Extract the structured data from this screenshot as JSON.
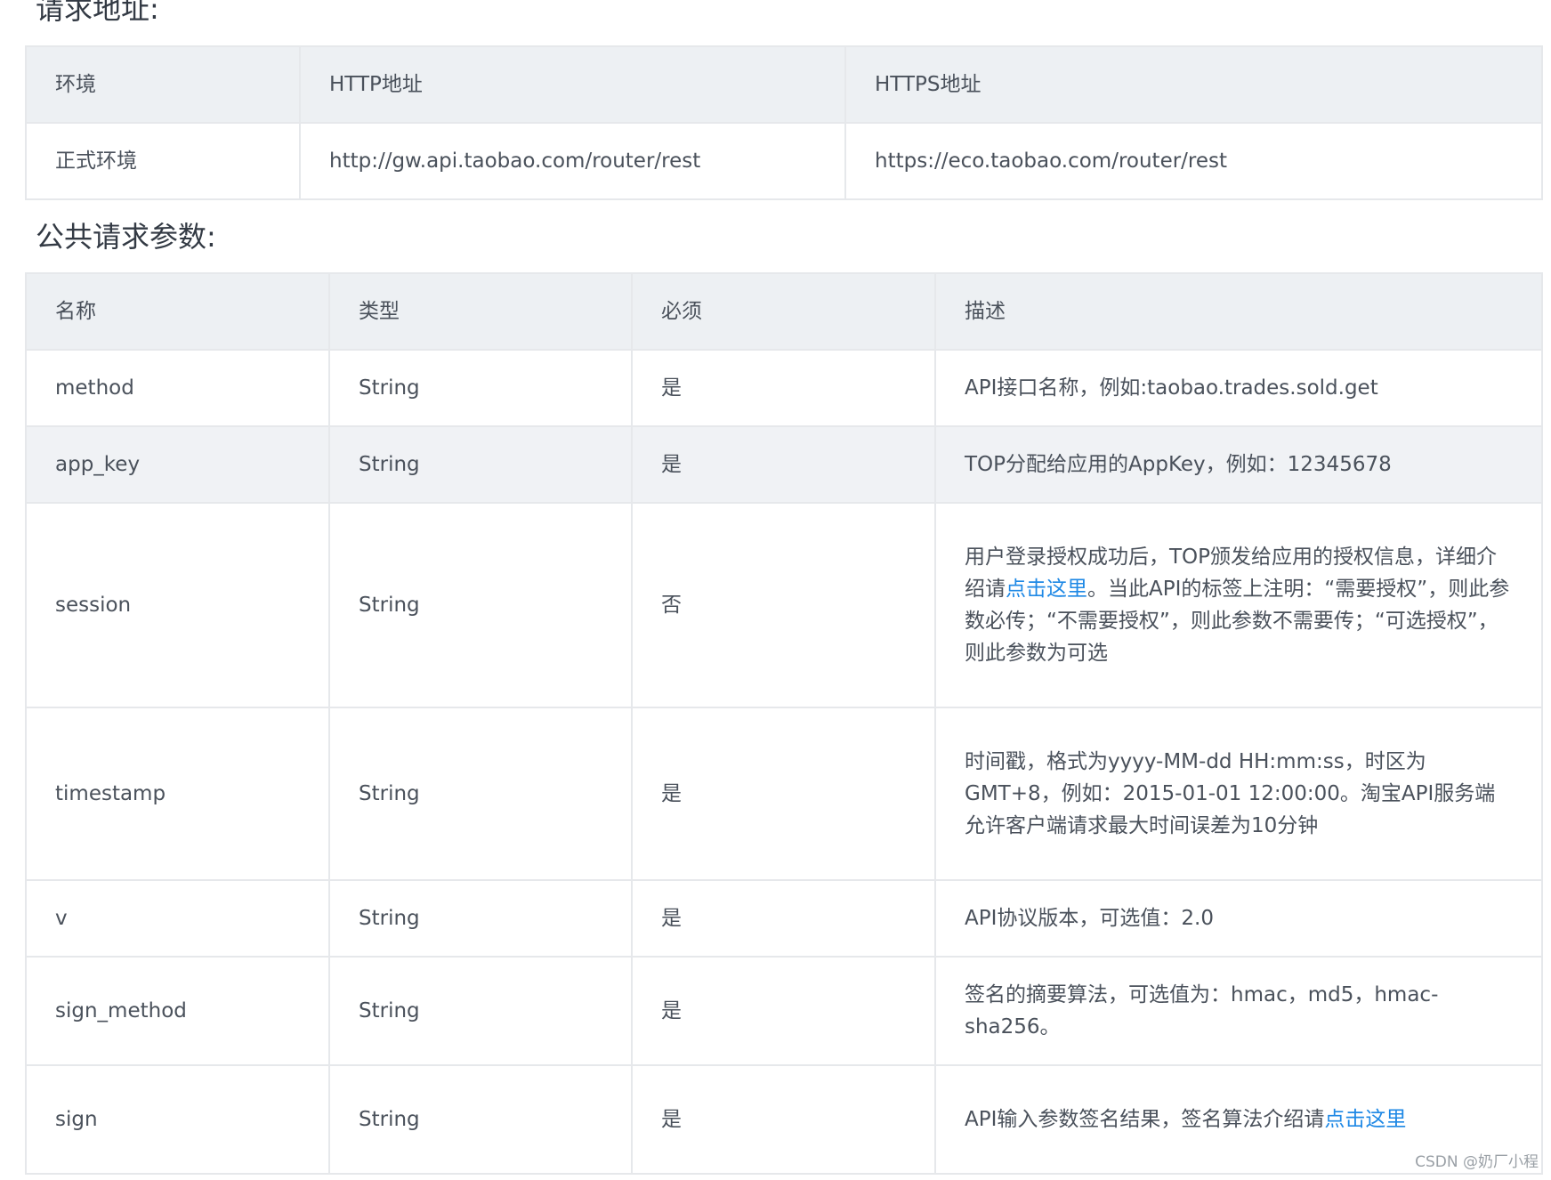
{
  "headings": {
    "request_address": "请求地址:",
    "common_params": "公共请求参数:"
  },
  "address_table": {
    "headers": [
      "环境",
      "HTTP地址",
      "HTTPS地址"
    ],
    "rows": [
      [
        "正式环境",
        "http://gw.api.taobao.com/router/rest",
        "https://eco.taobao.com/router/rest"
      ]
    ]
  },
  "params_table": {
    "headers": [
      "名称",
      "类型",
      "必须",
      "描述"
    ],
    "rows": [
      {
        "name": "method",
        "type": "String",
        "required": "是",
        "desc": "API接口名称，例如:taobao.trades.sold.get"
      },
      {
        "name": "app_key",
        "type": "String",
        "required": "是",
        "desc": "TOP分配给应用的AppKey，例如：12345678"
      },
      {
        "name": "session",
        "type": "String",
        "required": "否",
        "desc_before": "用户登录授权成功后，TOP颁发给应用的授权信息，详细介绍请",
        "desc_link": "点击这里",
        "desc_after": "。当此API的标签上注明：“需要授权”，则此参数必传；“不需要授权”，则此参数不需要传；“可选授权”，则此参数为可选"
      },
      {
        "name": "timestamp",
        "type": "String",
        "required": "是",
        "desc": "时间戳，格式为yyyy-MM-dd HH:mm:ss，时区为GMT+8，例如：2015-01-01 12:00:00。淘宝API服务端允许客户端请求最大时间误差为10分钟"
      },
      {
        "name": "v",
        "type": "String",
        "required": "是",
        "desc": "API协议版本，可选值：2.0"
      },
      {
        "name": "sign_method",
        "type": "String",
        "required": "是",
        "desc": "签名的摘要算法，可选值为：hmac，md5，hmac-sha256。"
      },
      {
        "name": "sign",
        "type": "String",
        "required": "是",
        "desc_before": "API输入参数签名结果，签名算法介绍请",
        "desc_link": "点击这里",
        "desc_after": ""
      }
    ]
  },
  "watermark": "CSDN @奶厂小程"
}
